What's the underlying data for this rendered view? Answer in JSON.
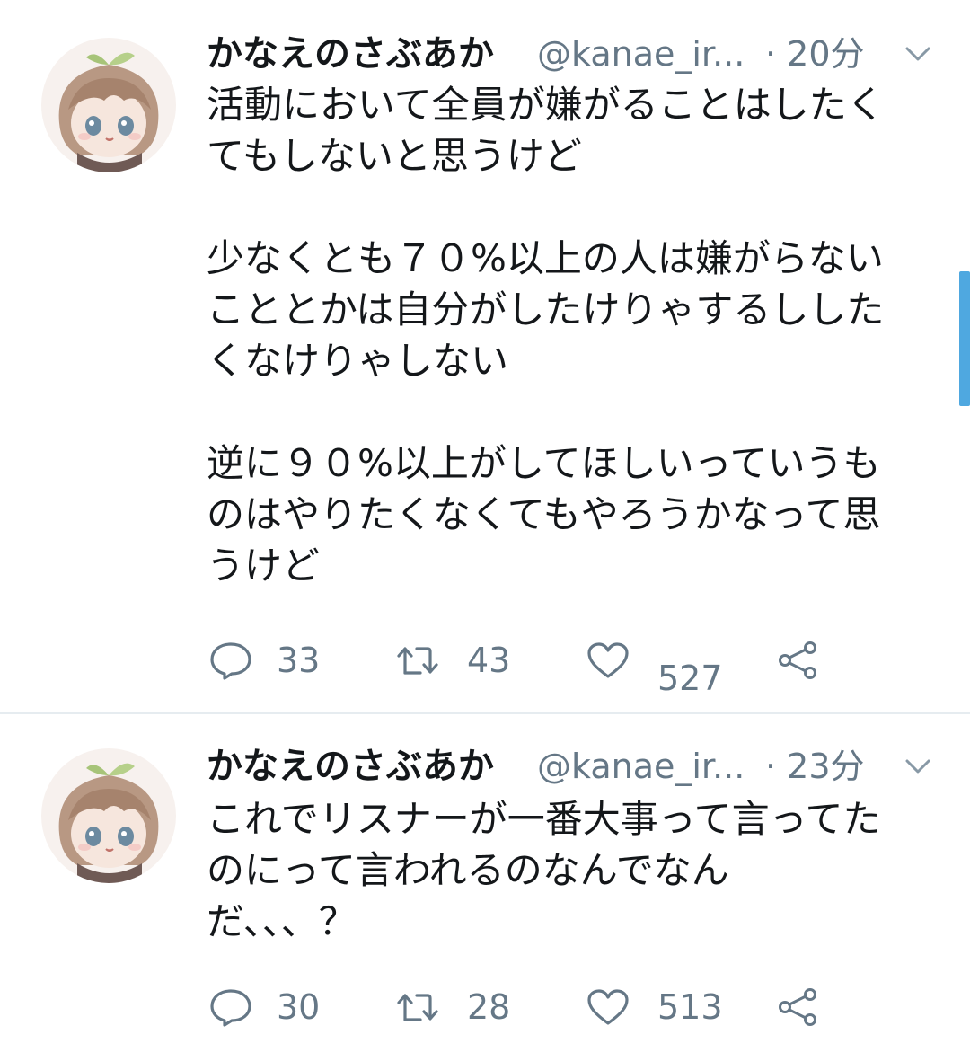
{
  "tweets": [
    {
      "name": "かなえのさぶあか",
      "handle": "@kanae_ir...",
      "time": "· 20分",
      "lines": [
        "活動において全員が嫌がることはしたく",
        "てもしないと思うけど",
        "",
        "少なくとも７０%以上の人は嫌がらない",
        "こととかは自分がしたけりゃするしした",
        "くなけりゃしない",
        "",
        "逆に９０%以上がしてほしいっていうも",
        "のはやりたくなくてもやろうかなって思",
        "うけど"
      ],
      "reply_count": "33",
      "retweet_count": "43",
      "like_count": "527"
    },
    {
      "name": "かなえのさぶあか",
      "handle": "@kanae_ir...",
      "time": "· 23分",
      "lines": [
        "これでリスナーが一番大事って言ってた",
        "のにって言われるのなんでなん",
        "だ、、、？"
      ],
      "reply_count": "30",
      "retweet_count": "28",
      "like_count": "513"
    }
  ],
  "icons": {
    "reply": "speech-bubble-icon",
    "retweet": "retweet-arrows-icon",
    "like": "heart-icon",
    "share": "share-icon",
    "caret": "chevron-down-icon"
  },
  "colors": {
    "text": "#14171a",
    "secondary": "#657786",
    "divider": "#e6ecf0",
    "scrollbar": "#4fa8e0"
  }
}
